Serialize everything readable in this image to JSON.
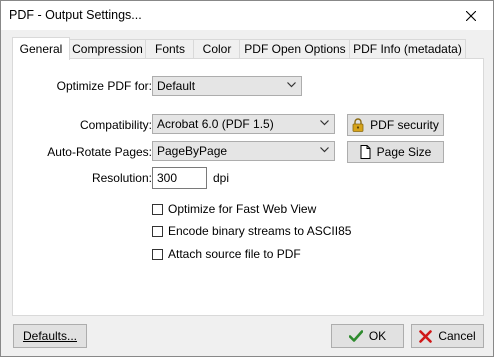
{
  "window": {
    "title": "PDF - Output Settings..."
  },
  "tabs": [
    {
      "label": "General",
      "active": true
    },
    {
      "label": "Compression",
      "active": false
    },
    {
      "label": "Fonts",
      "active": false
    },
    {
      "label": "Color",
      "active": false
    },
    {
      "label": "PDF Open Options",
      "active": false
    },
    {
      "label": "PDF Info (metadata)",
      "active": false
    }
  ],
  "general": {
    "optimize_label": "Optimize PDF for:",
    "optimize_value": "Default",
    "compatibility_label": "Compatibility:",
    "compatibility_value": "Acrobat 6.0 (PDF 1.5)",
    "autorotate_label": "Auto-Rotate Pages:",
    "autorotate_value": "PageByPage",
    "resolution_label": "Resolution:",
    "resolution_value": "300",
    "resolution_unit": "dpi",
    "pdf_security_label": "PDF security",
    "page_size_label": "Page Size",
    "checkboxes": [
      {
        "label": "Optimize for Fast Web View",
        "checked": false
      },
      {
        "label": "Encode binary streams to ASCII85",
        "checked": false
      },
      {
        "label": "Attach source file to PDF",
        "checked": false
      }
    ]
  },
  "footer": {
    "defaults_label": "Defaults...",
    "ok_label": "OK",
    "cancel_label": "Cancel"
  },
  "colors": {
    "ok_check": "#2e8b2e",
    "cancel_x": "#d01818",
    "lock_gold": "#d6a31a"
  },
  "icons": {
    "close": "close-icon",
    "dropdown": "chevron-down-icon",
    "security": "lock-icon",
    "page_size": "page-icon",
    "ok": "checkmark-icon",
    "cancel": "x-icon"
  }
}
